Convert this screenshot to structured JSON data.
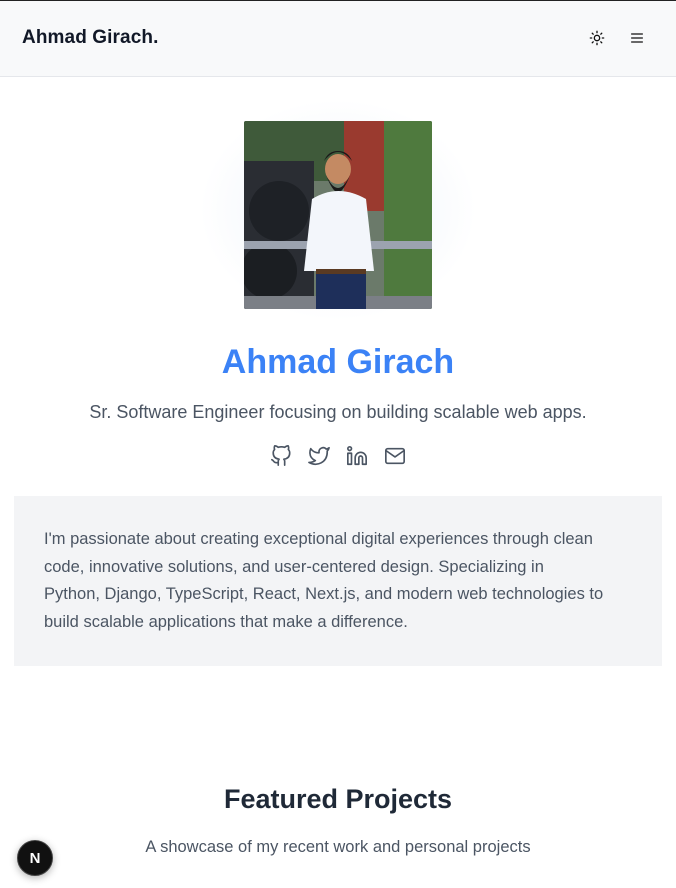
{
  "header": {
    "brand": "Ahmad Girach.",
    "theme_toggle_icon": "sun-icon",
    "menu_icon": "hamburger-menu-icon"
  },
  "hero": {
    "avatar_alt": "Ahmad Girach",
    "name": "Ahmad Girach",
    "tagline": "Sr. Software Engineer focusing on building scalable web apps.",
    "socials": [
      {
        "icon": "github-icon"
      },
      {
        "icon": "twitter-icon"
      },
      {
        "icon": "linkedin-icon"
      },
      {
        "icon": "mail-icon"
      }
    ]
  },
  "about": {
    "text": "I'm passionate about creating exceptional digital experiences through clean code, innovative solutions, and user-centered design. Specializing in Python, Django, TypeScript, React, Next.js, and modern web technologies to build scalable applications that make a difference."
  },
  "projects": {
    "title": "Featured Projects",
    "subtitle": "A showcase of my recent work and personal projects"
  },
  "dev_badge": {
    "label": "N"
  },
  "colors": {
    "accent": "#3b82f6",
    "header_bg": "#f8f9fa",
    "card_bg": "#f3f4f6"
  }
}
